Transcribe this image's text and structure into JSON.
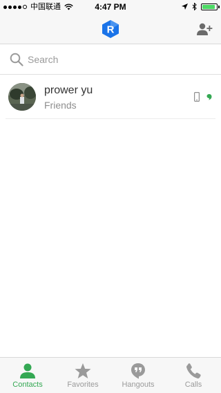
{
  "status_bar": {
    "carrier": "中国联通",
    "time": "4:47 PM",
    "signal_bars": 4,
    "battery_level": 0.9
  },
  "nav": {
    "logo_letter": "R",
    "add_contact_icon": "add-person-icon"
  },
  "search": {
    "placeholder": "Search"
  },
  "contacts": [
    {
      "name": "prower yu",
      "group": "Friends",
      "device_icon": "phone-icon",
      "status": "online"
    }
  ],
  "tabs": [
    {
      "label": "Contacts",
      "icon": "person-icon",
      "active": true
    },
    {
      "label": "Favorites",
      "icon": "star-icon",
      "active": false
    },
    {
      "label": "Hangouts",
      "icon": "quote-bubble-icon",
      "active": false
    },
    {
      "label": "Calls",
      "icon": "phone-handset-icon",
      "active": false
    }
  ],
  "colors": {
    "accent": "#34a853",
    "brand": "#1a73e8",
    "inactive": "#9a9a9a"
  }
}
